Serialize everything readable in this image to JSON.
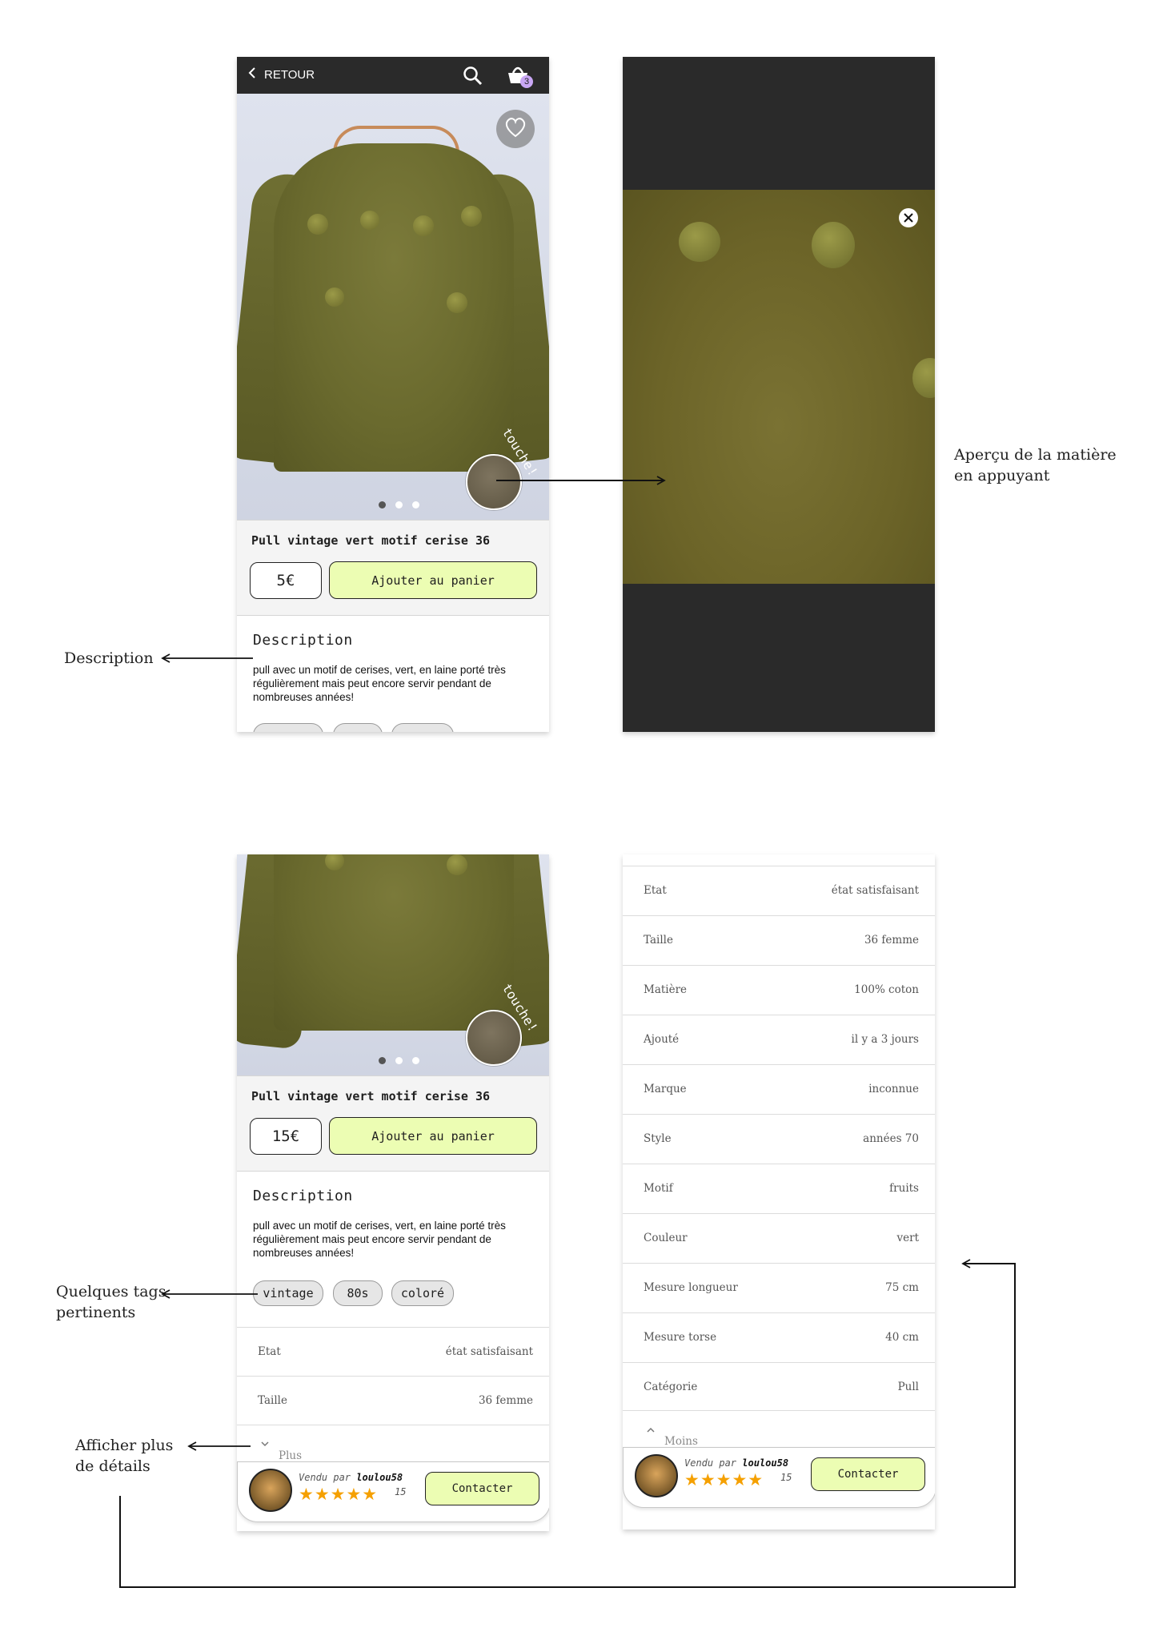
{
  "screen1": {
    "back_label": "RETOUR",
    "cart_count": "3",
    "touch_label": "touche!",
    "product_title": "Pull vintage vert motif cerise 36",
    "price": "5€",
    "add_to_cart": "Ajouter au panier",
    "description_title": "Description",
    "description_text": "pull avec un motif de cerises, vert, en laine porté très régulièrement mais peut encore servir pendant de nombreuses années!"
  },
  "screen3": {
    "touch_label": "touche!",
    "product_title": "Pull vintage vert motif cerise 36",
    "price": "15€",
    "add_to_cart": "Ajouter au panier",
    "description_title": "Description",
    "description_text": "pull avec un motif de cerises, vert, en laine porté très régulièrement mais peut encore servir pendant de nombreuses années!",
    "tags": [
      "vintage",
      "80s",
      "coloré"
    ],
    "details": [
      {
        "key": "Etat",
        "value": "état satisfaisant"
      },
      {
        "key": "Taille",
        "value": "36 femme"
      }
    ],
    "more_details": "Plus de détails",
    "seller": {
      "prefix": "Vendu par",
      "name": "loulou58",
      "stars": "★★★★★",
      "rating_count": "15",
      "contact": "Contacter"
    }
  },
  "screen4": {
    "details": [
      {
        "key": "Etat",
        "value": "état satisfaisant"
      },
      {
        "key": "Taille",
        "value": "36 femme"
      },
      {
        "key": "Matière",
        "value": "100% coton"
      },
      {
        "key": "Ajouté",
        "value": "il y a 3 jours"
      },
      {
        "key": "Marque",
        "value": "inconnue"
      },
      {
        "key": "Style",
        "value": "années 70"
      },
      {
        "key": "Motif",
        "value": "fruits"
      },
      {
        "key": "Couleur",
        "value": "vert"
      },
      {
        "key": "Mesure longueur",
        "value": "75 cm"
      },
      {
        "key": "Mesure torse",
        "value": "40 cm"
      },
      {
        "key": "Catégorie",
        "value": "Pull"
      }
    ],
    "less_details": "Moins de détails",
    "seller": {
      "prefix": "Vendu par",
      "name": "loulou58",
      "stars": "★★★★★",
      "rating_count": "15",
      "contact": "Contacter"
    }
  },
  "annotations": {
    "texture": "Aperçu de la matière en appuyant",
    "description": "Description",
    "tags": "Quelques tags pertinents",
    "more": "Afficher plus de détails"
  },
  "colors": {
    "accent": "#ecfdb3",
    "topbar": "#2a2a2a",
    "stars": "#f5a000",
    "cart_badge": "#c9a7f5"
  }
}
